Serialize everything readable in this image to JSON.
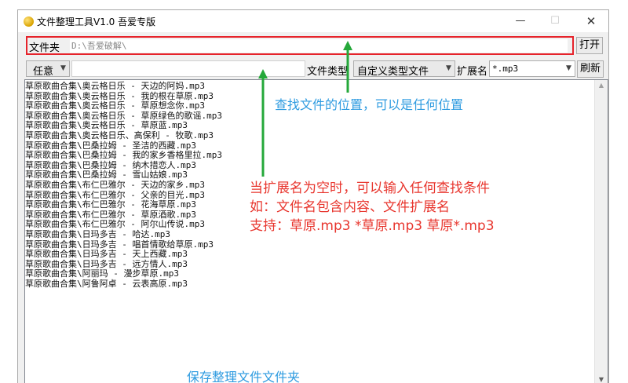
{
  "window": {
    "title": "文件整理工具V1.0 吾爱专版",
    "controls": {
      "minimize": "—",
      "maximize": "☐",
      "close": "✕"
    }
  },
  "toolbar": {
    "folder_label": "文件夹",
    "folder_path": "D:\\吾爱破解\\",
    "open_label": "打开",
    "match_mode": "任意",
    "condition_value": "",
    "file_type_label": "文件类型",
    "file_type_value": "自定义类型文件",
    "extension_label": "扩展名",
    "extension_value": "*.mp3",
    "refresh_label": "刷新"
  },
  "files": [
    "草原歌曲合集\\奥云格日乐 - 天边的阿妈.mp3",
    "草原歌曲合集\\奥云格日乐 - 我的根在草原.mp3",
    "草原歌曲合集\\奥云格日乐 - 草原想念你.mp3",
    "草原歌曲合集\\奥云格日乐 - 草原绿色的歌谣.mp3",
    "草原歌曲合集\\奥云格日乐 - 草原蓝.mp3",
    "草原歌曲合集\\奥云格日乐、高保利 - 牧歌.mp3",
    "草原歌曲合集\\巴桑拉姆 - 圣洁的西藏.mp3",
    "草原歌曲合集\\巴桑拉姆 - 我的家乡香格里拉.mp3",
    "草原歌曲合集\\巴桑拉姆 - 纳木措恋人.mp3",
    "草原歌曲合集\\巴桑拉姆 - 雪山姑娘.mp3",
    "草原歌曲合集\\布仁巴雅尔 - 天边的家乡.mp3",
    "草原歌曲合集\\布仁巴雅尔 - 父亲的目光.mp3",
    "草原歌曲合集\\布仁巴雅尔 - 花海草原.mp3",
    "草原歌曲合集\\布仁巴雅尔 - 草原酒歌.mp3",
    "草原歌曲合集\\布仁巴雅尔 - 阿尔山传说.mp3",
    "草原歌曲合集\\日玛多吉 - 哈达.mp3",
    "草原歌曲合集\\日玛多吉 - 唱首情歌给草原.mp3",
    "草原歌曲合集\\日玛多吉 - 天上西藏.mp3",
    "草原歌曲合集\\日玛多吉 - 远方情人.mp3",
    "草原歌曲合集\\阿丽玛 - 漫步草原.mp3",
    "草原歌曲合集\\阿鲁阿卓 - 云表高原.mp3"
  ],
  "annotations": {
    "location_note": "查找文件的位置，可以是任何位置",
    "ext_note_line1": "当扩展名为空时，可以输入任何查找条件",
    "ext_note_line2": "如：文件名包含内容、文件扩展名",
    "ext_note_line3": "支持：草原.mp3   *草原.mp3    草原*.mp3",
    "save_note": "保存整理文件文件夹"
  },
  "colors": {
    "highlight_red": "#e6232b",
    "annotation_blue": "#2e9be0",
    "annotation_red": "#e8362e",
    "arrow_green": "#25a83a"
  }
}
